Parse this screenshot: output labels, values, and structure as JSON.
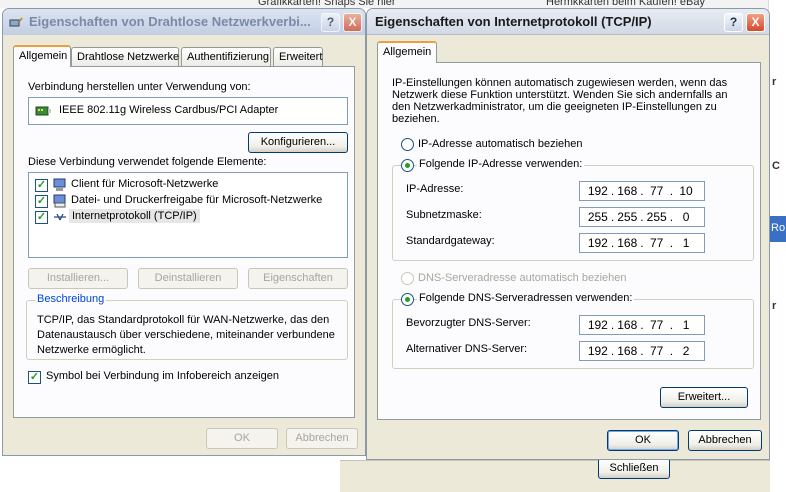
{
  "background": {
    "top_left_fragment": "Grafikkarten! Snaps Sie hier",
    "top_right_fragment": "Hermkkarten beim Kaufen! eBay",
    "side_blue_button": "Ro",
    "side_letter_1": "r",
    "side_letter_2": "C",
    "side_letter_3": "r",
    "close_button": "Schließen"
  },
  "connection_dialog": {
    "title": "Eigenschaften von Drahtlose Netzwerkverbi...",
    "tabs": [
      "Allgemein",
      "Drahtlose Netzwerke",
      "Authentifizierung",
      "Erweitert"
    ],
    "connect_using_label": "Verbindung herstellen unter Verwendung von:",
    "adapter_name": "IEEE 802.11g Wireless Cardbus/PCI Adapter",
    "configure_button": "Konfigurieren...",
    "items_label": "Diese Verbindung verwendet folgende Elemente:",
    "items": [
      {
        "label": "Client für Microsoft-Netzwerke",
        "checked": true,
        "icon": "network-client-icon"
      },
      {
        "label": "Datei- und Druckerfreigabe für Microsoft-Netzwerke",
        "checked": true,
        "icon": "file-printer-sharing-icon"
      },
      {
        "label": "Internetprotokoll (TCP/IP)",
        "checked": true,
        "icon": "protocol-icon"
      }
    ],
    "install_button": "Installieren...",
    "uninstall_button": "Deinstallieren",
    "properties_button": "Eigenschaften",
    "description_title": "Beschreibung",
    "description_text": "TCP/IP, das Standardprotokoll für WAN-Netzwerke, das den Datenaustausch über verschiedene, miteinander verbundene Netzwerke ermöglicht.",
    "tray_icon_label": "Symbol bei Verbindung im Infobereich anzeigen",
    "tray_icon_checked": true,
    "ok_button": "OK",
    "cancel_button": "Abbrechen"
  },
  "tcpip_dialog": {
    "title": "Eigenschaften von Internetprotokoll (TCP/IP)",
    "tab": "Allgemein",
    "intro_text": "IP-Einstellungen können automatisch zugewiesen werden, wenn das Netzwerk diese Funktion unterstützt. Wenden Sie sich andernfalls an den Netzwerkadministrator, um die geeigneten IP-Einstellungen zu beziehen.",
    "auto_ip_label": "IP-Adresse automatisch beziehen",
    "manual_ip_label": "Folgende IP-Adresse verwenden:",
    "ip_label": "IP-Adresse:",
    "ip_value": [
      "192",
      "168",
      "77",
      "10"
    ],
    "subnet_label": "Subnetzmaske:",
    "subnet_value": [
      "255",
      "255",
      "255",
      "0"
    ],
    "gateway_label": "Standardgateway:",
    "gateway_value": [
      "192",
      "168",
      "77",
      "1"
    ],
    "auto_dns_label": "DNS-Serveradresse automatisch beziehen",
    "manual_dns_label": "Folgende DNS-Serveradressen verwenden:",
    "preferred_dns_label": "Bevorzugter DNS-Server:",
    "preferred_dns_value": [
      "192",
      "168",
      "77",
      "1"
    ],
    "alternate_dns_label": "Alternativer DNS-Server:",
    "alternate_dns_value": [
      "192",
      "168",
      "77",
      "2"
    ],
    "advanced_button": "Erweitert...",
    "ok_button": "OK",
    "cancel_button": "Abbrechen"
  },
  "titlebar_buttons": {
    "help": "?",
    "close": "X"
  }
}
